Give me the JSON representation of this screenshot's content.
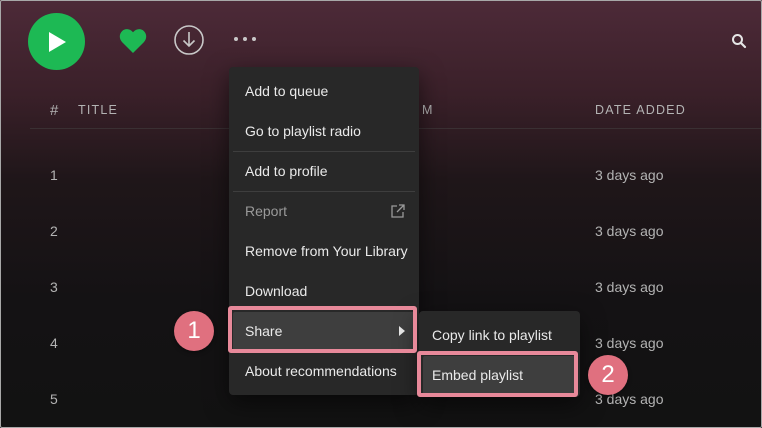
{
  "toolbar": {
    "play_icon": "play-icon",
    "like_icon": "heart-icon",
    "download_icon": "download-icon",
    "more_icon": "more-options-icon",
    "search_icon": "search-icon"
  },
  "table": {
    "headers": {
      "number": "#",
      "title": "TITLE",
      "album_partial": "M",
      "date_added": "DATE ADDED"
    },
    "rows": [
      {
        "number": "1",
        "date_added": "3 days ago"
      },
      {
        "number": "2",
        "date_added": "3 days ago"
      },
      {
        "number": "3",
        "date_added": "3 days ago"
      },
      {
        "number": "4",
        "date_added": "3 days ago"
      },
      {
        "number": "5",
        "date_added": "3 days ago"
      }
    ]
  },
  "context_menu": {
    "items": [
      {
        "label": "Add to queue"
      },
      {
        "label": "Go to playlist radio"
      },
      {
        "label": "Add to profile"
      },
      {
        "label": "Report"
      },
      {
        "label": "Remove from Your Library"
      },
      {
        "label": "Download"
      },
      {
        "label": "Share"
      },
      {
        "label": "About recommendations"
      }
    ]
  },
  "share_submenu": {
    "items": [
      {
        "label": "Copy link to playlist"
      },
      {
        "label": "Embed playlist"
      }
    ]
  },
  "annotations": {
    "step1": "1",
    "step2": "2"
  },
  "colors": {
    "accent_green": "#1db954",
    "highlight_pink": "#e8899a",
    "badge_pink": "#e0707f",
    "menu_bg": "#282828"
  }
}
